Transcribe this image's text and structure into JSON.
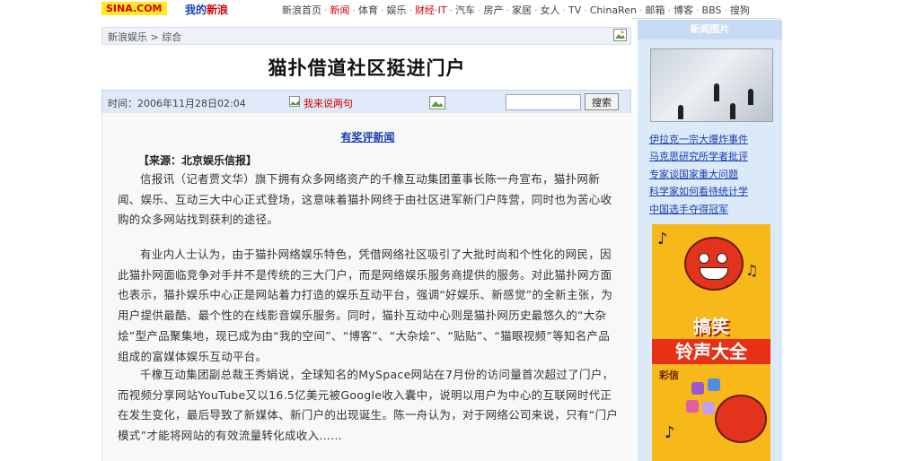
{
  "header": {
    "logo": "SINA.COM",
    "logo_sina_1": "我的",
    "logo_sina_2": "新浪",
    "nav": [
      {
        "label": "新浪首页",
        "hot": false
      },
      {
        "label": "新闻",
        "hot": true
      },
      {
        "label": "体育",
        "hot": false
      },
      {
        "label": "娱乐",
        "hot": false
      },
      {
        "label": "财经·IT",
        "hot": true
      },
      {
        "label": "汽车",
        "hot": false
      },
      {
        "label": "房产",
        "hot": false
      },
      {
        "label": "家居",
        "hot": false
      },
      {
        "label": "女人",
        "hot": false
      },
      {
        "label": "TV",
        "hot": false
      },
      {
        "label": "ChinaRen",
        "hot": false
      },
      {
        "label": "邮箱",
        "hot": false
      },
      {
        "label": "博客",
        "hot": false
      },
      {
        "label": "BBS",
        "hot": false
      },
      {
        "label": "搜狗",
        "hot": false
      }
    ]
  },
  "breadcrumb": "新浪娱乐 > 综合",
  "article": {
    "title": "猫扑借道社区挺进门户",
    "time": "时间：2006年11月28日02:04",
    "share_link": "我来说两句",
    "search_button": "搜索",
    "comment_link": "有奖评新闻",
    "source": "【来源：北京娱乐信报】",
    "paragraphs": [
      "信报讯（记者贾文华）旗下拥有众多网络资产的千橡互动集团董事长陈一舟宣布，猫扑网新闻、娱乐、互动三大中心正式登场，这意味着猫扑网终于由社区进军新门户阵营，同时也为苦心收购的众多网站找到获利的途径。",
      "有业内人士认为，由于猫扑网络娱乐特色，凭借网络社区吸引了大批时尚和个性化的网民，因此猫扑网面临竞争对手并不是传统的三大门户，而是网络娱乐服务商提供的服务。对此猫扑网方面也表示，猫扑娱乐中心正是网站着力打造的娱乐互动平台，强调“好娱乐、新感觉”的全新主张，为用户提供最酷、最个性的在线影音娱乐服务。同时，猫扑互动中心则是猫扑网历史最悠久的“大杂烩”型产品聚集地，现已成为由“我的空间”、“博客”、“大杂烩”、“贴贴”、“猫眼视频”等知名产品组成的富媒体娱乐互动平台。",
      "千橡互动集团副总裁王秀娟说，全球知名的MySpace网站在7月份的访问量首次超过了门户，而视频分享网站YouTube又以16.5亿美元被Google收入囊中，说明以用户为中心的互联网时代正在发生变化，最后导致了新媒体、新门户的出现诞生。陈一舟认为，对于网络公司来说，只有“门户模式”才能将网站的有效流量转化成收入……"
    ]
  },
  "sidebar": {
    "header": "新闻图片",
    "links": [
      "伊拉克一宗大爆炸事件",
      "马克思研究所学者批评",
      "专家谈国家重大问题",
      "科学家如何看待统计学",
      "中国选手夺得冠军"
    ],
    "ad": {
      "title_1": "搞笑",
      "title_2": "铃声大全",
      "tag": "彩信"
    }
  }
}
